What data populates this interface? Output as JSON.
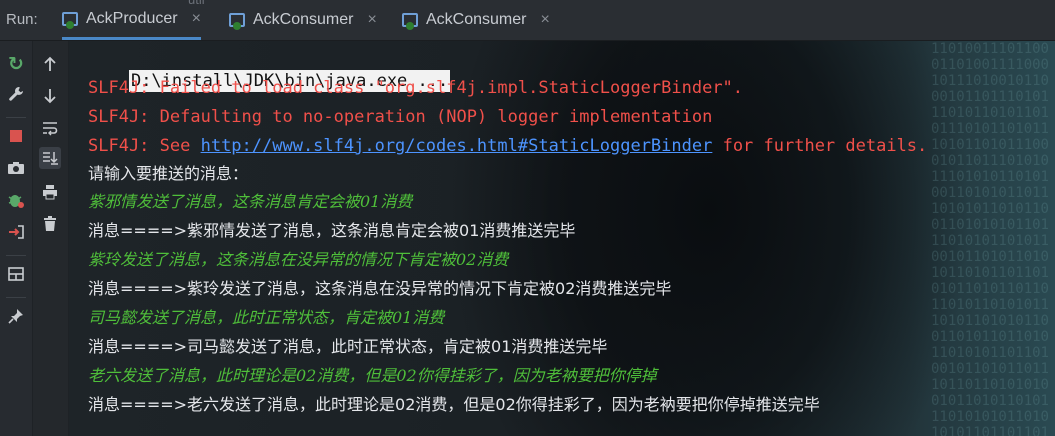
{
  "runbar": {
    "run_label": "Run:",
    "faded_text": "util",
    "tabs": [
      {
        "label": "AckProducer",
        "close": "×",
        "active": true
      },
      {
        "label": "AckConsumer",
        "close": "×",
        "active": false
      },
      {
        "label": "AckConsumer",
        "close": "×",
        "active": false
      }
    ]
  },
  "toolbar_left": [
    {
      "icon": "rerun-icon",
      "glyph": "↻",
      "color": "#59a869"
    },
    {
      "icon": "wrench-icon",
      "glyph": "🔧",
      "color": "#c9ccd0"
    },
    {
      "icon": "stop-icon",
      "glyph": "■",
      "color": "#d9534f"
    },
    {
      "icon": "camera-icon",
      "glyph": "📷",
      "color": "#c9ccd0"
    },
    {
      "icon": "debug-icon",
      "glyph": "✱",
      "color": "#59a869"
    },
    {
      "icon": "exit-icon",
      "glyph": "⇥",
      "color": "#d9534f"
    },
    {
      "icon": "layout-icon",
      "glyph": "▦",
      "color": "#c9ccd0"
    },
    {
      "icon": "pin-icon",
      "glyph": "📌",
      "color": "#c9ccd0"
    }
  ],
  "toolbar_right": [
    {
      "icon": "up-arrow-icon",
      "glyph": "↑"
    },
    {
      "icon": "down-arrow-icon",
      "glyph": "↓"
    },
    {
      "icon": "soft-wrap-icon",
      "glyph": "↩"
    },
    {
      "icon": "scroll-to-end-icon",
      "glyph": "⇊"
    },
    {
      "icon": "print-icon",
      "glyph": "⎙"
    },
    {
      "icon": "trash-icon",
      "glyph": "🗑"
    }
  ],
  "console": {
    "cmd": "D:\\install\\JDK\\bin\\java.exe ...",
    "slf1": "SLF4J: Failed to load class \"org.slf4j.impl.StaticLoggerBinder\".",
    "slf2": "SLF4J: Defaulting to no-operation (NOP) logger implementation",
    "slf3_prefix": "SLF4J: See ",
    "slf3_link": "http://www.slf4j.org/codes.html#StaticLoggerBinder",
    "slf3_suffix": " for further details.",
    "prompt": "请输入要推送的消息：",
    "in1": "紫邪情发送了消息，这条消息肯定会被01消费",
    "out1": "消息====>紫邪情发送了消息，这条消息肯定会被01消费推送完毕",
    "in2": "紫玲发送了消息，这条消息在没异常的情况下肯定被02消费",
    "out2": "消息====>紫玲发送了消息，这条消息在没异常的情况下肯定被02消费推送完毕",
    "in3": "司马懿发送了消息，此时正常状态，肯定被01消费",
    "out3": "消息====>司马懿发送了消息，此时正常状态，肯定被01消费推送完毕",
    "in4": "老六发送了消息，此时理论是02消费，但是02你得挂彩了，因为老衲要把你停掉",
    "out4": "消息====>老六发送了消息，此时理论是02消费，但是02你得挂彩了，因为老衲要把你停掉推送完毕"
  },
  "colors": {
    "error_red": "#f0504a",
    "input_green": "#4fbf3a",
    "link_blue": "#4d94ff",
    "tab_underline": "#4a88c7"
  }
}
